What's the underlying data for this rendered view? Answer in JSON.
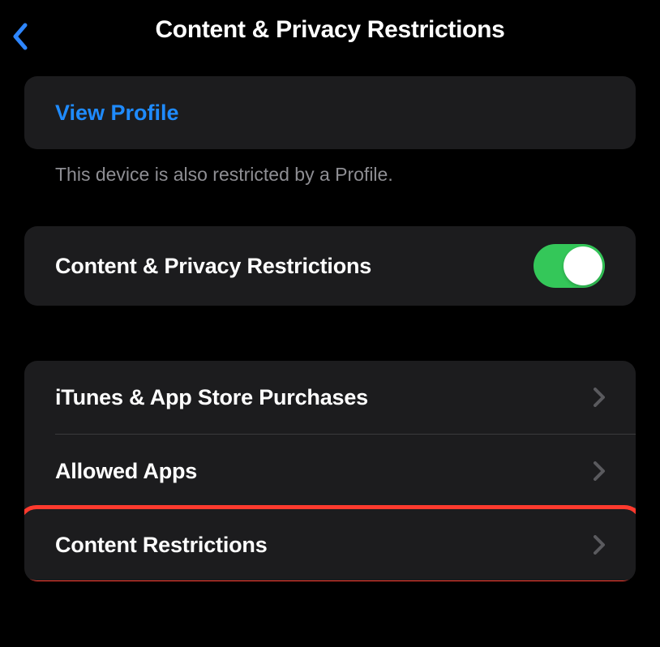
{
  "nav": {
    "title": "Content & Privacy Restrictions"
  },
  "profile": {
    "view_label": "View Profile",
    "footer": "This device is also restricted by a Profile."
  },
  "master_toggle": {
    "label": "Content & Privacy Restrictions",
    "on": true
  },
  "rows": [
    {
      "label": "iTunes & App Store Purchases"
    },
    {
      "label": "Allowed Apps"
    },
    {
      "label": "Content Restrictions"
    }
  ]
}
